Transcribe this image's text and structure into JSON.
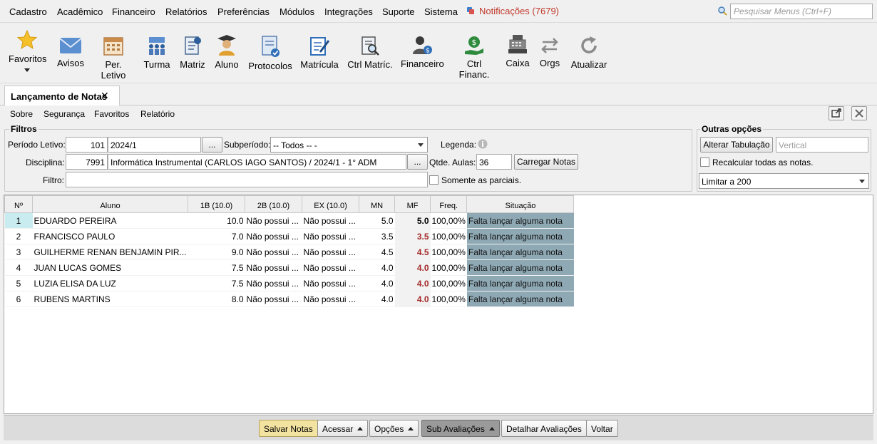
{
  "menu": {
    "items": [
      {
        "label": "Cadastro"
      },
      {
        "label": "Acadêmico"
      },
      {
        "label": "Financeiro"
      },
      {
        "label": "Relatórios"
      },
      {
        "label": "Preferências"
      },
      {
        "label": "Módulos"
      },
      {
        "label": "Integrações"
      },
      {
        "label": "Suporte"
      },
      {
        "label": "Sistema"
      }
    ],
    "notifications": "Notificações (7679)",
    "search_placeholder": "Pesquisar Menus (Ctrl+F)"
  },
  "toolbar": {
    "favoritos": "Favoritos",
    "avisos": "Avisos",
    "per_letivo": "Per. Letivo",
    "turma": "Turma",
    "matriz": "Matriz",
    "aluno": "Aluno",
    "protocolos": "Protocolos",
    "matricula": "Matrícula",
    "ctrl_matric": "Ctrl Matríc.",
    "financeiro": "Financeiro",
    "ctrl_financ": "Ctrl Financ.",
    "caixa": "Caixa",
    "orgs": "Orgs",
    "atualizar": "Atualizar"
  },
  "tab": {
    "title": "Lançamento de Notas",
    "close": "✕"
  },
  "submenu": {
    "sobre": "Sobre",
    "seguranca": "Segurança",
    "favoritos": "Favoritos",
    "relatorio": "Relatório"
  },
  "filtros": {
    "legend": "Filtros",
    "periodo_label": "Período Letivo:",
    "periodo_code": "101",
    "periodo_name": "2024/1",
    "subperiodo_label": "Subperíodo:",
    "subperiodo_value": "-- Todos -- -",
    "legenda_label": "Legenda:",
    "disciplina_label": "Disciplina:",
    "disciplina_code": "7991",
    "disciplina_name": "Informática Instrumental (CARLOS IAGO SANTOS) / 2024/1 - 1° ADM",
    "qtde_label": "Qtde. Aulas:",
    "qtde_value": "36",
    "carregar_button": "Carregar Notas",
    "filtro_label": "Filtro:",
    "filtro_value": "",
    "somente_parciais": "Somente as parciais.",
    "ellipsis": "..."
  },
  "outras": {
    "legend": "Outras opções",
    "alterar_button": "Alterar Tabulação",
    "tab_placeholder": "Vertical",
    "recalcular": "Recalcular todas as notas.",
    "limitar_value": "Limitar a 200"
  },
  "grid": {
    "headers": [
      "Nº",
      "Aluno",
      "1B (10.0)",
      "2B (10.0)",
      "EX (10.0)",
      "MN",
      "MF",
      "Freq.",
      "Situação"
    ],
    "rows": [
      {
        "n": "1",
        "aluno": "EDUARDO PEREIRA",
        "b1": "10.0",
        "b2": "Não possui ...",
        "ex": "Não possui ...",
        "mn": "5.0",
        "mf": "5.0",
        "freq": "100,00%",
        "sit": "Falta lançar alguma nota"
      },
      {
        "n": "2",
        "aluno": "FRANCISCO PAULO",
        "b1": "7.0",
        "b2": "Não possui ...",
        "ex": "Não possui ...",
        "mn": "3.5",
        "mf": "3.5",
        "freq": "100,00%",
        "sit": "Falta lançar alguma nota"
      },
      {
        "n": "3",
        "aluno": "GUILHERME RENAN BENJAMIN PIR...",
        "b1": "9.0",
        "b2": "Não possui ...",
        "ex": "Não possui ...",
        "mn": "4.5",
        "mf": "4.5",
        "freq": "100,00%",
        "sit": "Falta lançar alguma nota"
      },
      {
        "n": "4",
        "aluno": "JUAN LUCAS GOMES",
        "b1": "7.5",
        "b2": "Não possui ...",
        "ex": "Não possui ...",
        "mn": "4.0",
        "mf": "4.0",
        "freq": "100,00%",
        "sit": "Falta lançar alguma nota"
      },
      {
        "n": "5",
        "aluno": "LUZIA ELISA DA LUZ",
        "b1": "7.5",
        "b2": "Não possui ...",
        "ex": "Não possui ...",
        "mn": "4.0",
        "mf": "4.0",
        "freq": "100,00%",
        "sit": "Falta lançar alguma nota"
      },
      {
        "n": "6",
        "aluno": "RUBENS MARTINS",
        "b1": "8.0",
        "b2": "Não possui ...",
        "ex": "Não possui ...",
        "mn": "4.0",
        "mf": "4.0",
        "freq": "100,00%",
        "sit": "Falta lançar alguma nota"
      }
    ],
    "colors": {
      "mf_pass": "#000000",
      "mf_fail": "#a52a2a",
      "situacao_bg": "#8fa9b4"
    }
  },
  "footer": {
    "salvar": "Salvar Notas",
    "acessar": "Acessar",
    "opcoes": "Opções",
    "sub_avaliacoes": "Sub Avaliações",
    "detalhar": "Detalhar Avaliações",
    "voltar": "Voltar"
  }
}
